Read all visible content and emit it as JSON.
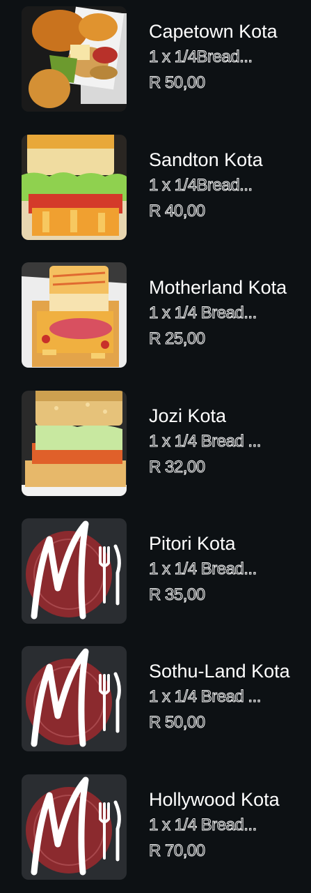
{
  "menu": {
    "items": [
      {
        "name": "Capetown Kota",
        "description": "1 x 1/4Bread...",
        "price": "R 50,00",
        "image": "capetown-kota-photo"
      },
      {
        "name": "Sandton Kota",
        "description": "1 x 1/4Bread...",
        "price": "R 40,00",
        "image": "sandton-kota-photo"
      },
      {
        "name": "Motherland Kota",
        "description": "1 x 1/4 Bread...",
        "price": "R 25,00",
        "image": "motherland-kota-photo"
      },
      {
        "name": "Jozi Kota",
        "description": "1 x 1/4 Bread ...",
        "price": "R 32,00",
        "image": "jozi-kota-photo"
      },
      {
        "name": "Pitori Kota",
        "description": "1 x 1/4 Bread...",
        "price": "R 35,00",
        "image": "restaurant-logo-placeholder"
      },
      {
        "name": "Sothu-Land Kota",
        "description": "1 x 1/4 Bread ...",
        "price": "R 50,00",
        "image": "restaurant-logo-placeholder"
      },
      {
        "name": "Hollywood Kota",
        "description": "1 x 1/4 Bread...",
        "price": "R 70,00",
        "image": "restaurant-logo-placeholder"
      }
    ]
  },
  "colors": {
    "background": "#0d1114",
    "logo_background": "#2a2d31",
    "logo_plate": "#8b2a2e",
    "text": "#ffffff"
  }
}
